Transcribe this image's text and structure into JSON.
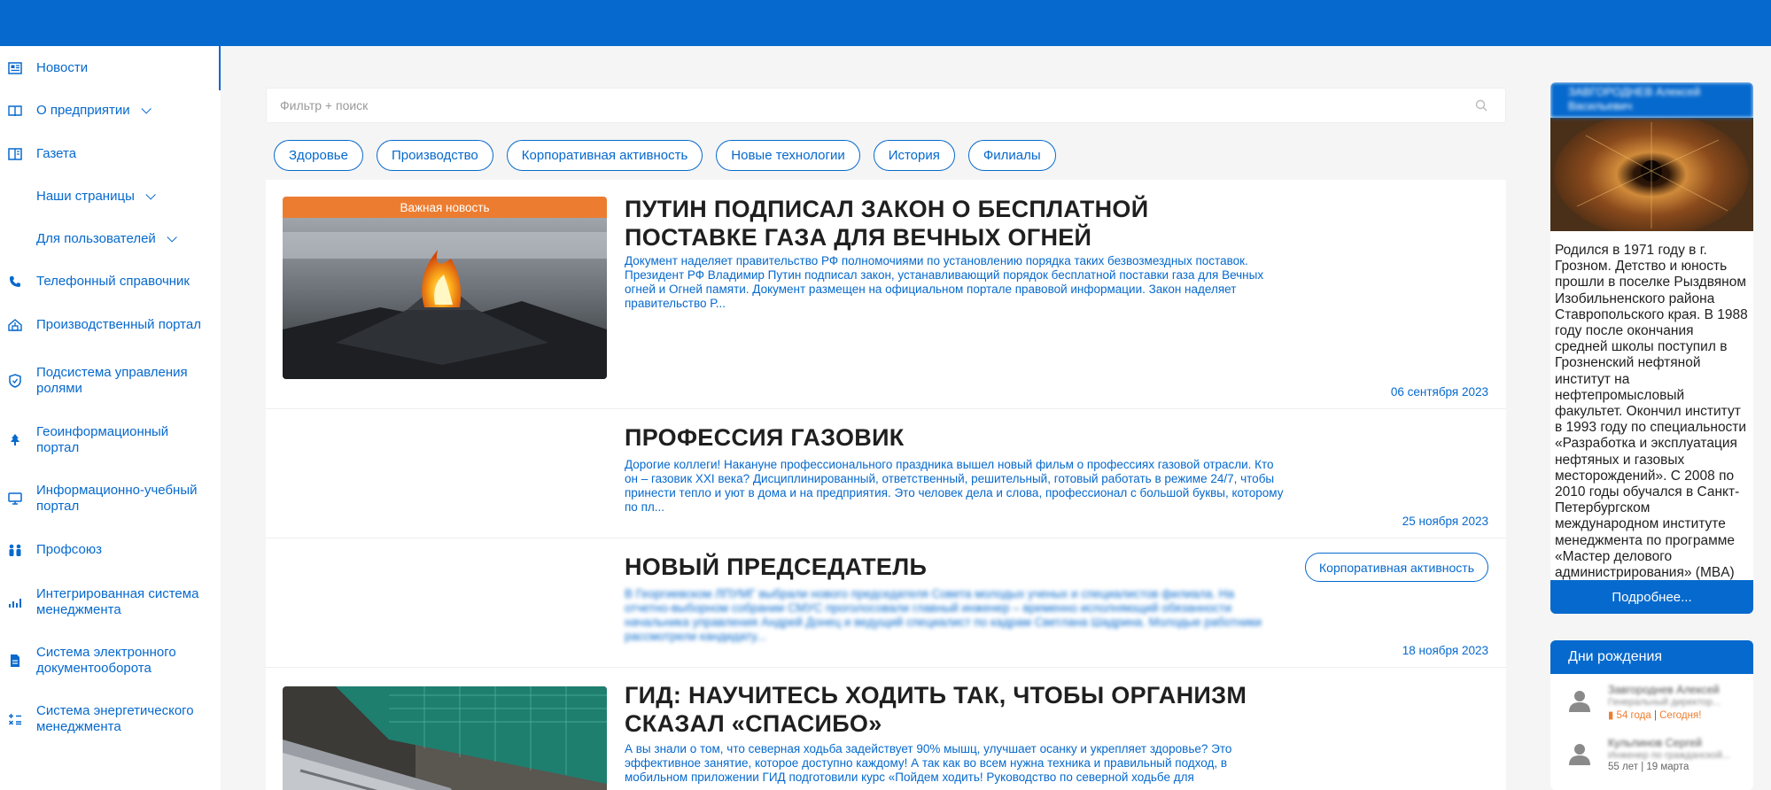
{
  "search": {
    "placeholder": "Фильтр + поиск"
  },
  "sidebar": {
    "items": [
      {
        "label": "Новости",
        "icon": "newspaper-icon"
      },
      {
        "label": "О предприятии",
        "icon": "book-open-icon"
      },
      {
        "label": "Газета",
        "icon": "columns-icon"
      },
      {
        "label": "Наши страницы"
      },
      {
        "label": "Для пользователей"
      },
      {
        "label": "Телефонный справочник",
        "icon": "phone-icon"
      },
      {
        "label": "Производственный портал",
        "icon": "factory-icon"
      },
      {
        "label": "Подсистема управления ролями",
        "icon": "shield-icon"
      },
      {
        "label": "Геоинформационный портал",
        "icon": "tree-icon"
      },
      {
        "label": "Информационно-учебный портал",
        "icon": "monitor-icon"
      },
      {
        "label": "Профсоюз",
        "icon": "people-icon"
      },
      {
        "label": "Интегрированная система менеджмента",
        "icon": "chart-icon"
      },
      {
        "label": "Система электронного документооборота",
        "icon": "document-icon"
      },
      {
        "label": "Система энергетического менеджмента",
        "icon": "calculator-icon"
      }
    ]
  },
  "chips": [
    "Здоровье",
    "Производство",
    "Корпоративная активность",
    "Новые технологии",
    "История",
    "Филиалы"
  ],
  "posts": [
    {
      "badge": "Важная новость",
      "title": "Путин подписал закон о бесплатной поставке газа для Вечных огней",
      "text": "Документ наделяет правительство РФ полномочиями по установлению порядка таких безвозмездных поставок. Президент РФ Владимир Путин подписал закон, устанавливающий порядок бесплатной поставки газа для Вечных огней и Огней памяти. Документ размещен на официальном портале правовой информации. Закон наделяет правительство Р...",
      "date": "06 сентября 2023"
    },
    {
      "title": "Профессия газовик",
      "text": "Дорогие коллеги! Накануне профессионального праздника вышел новый фильм о профессиях газовой отрасли. Кто он – газовик XXI века? Дисциплинированный, ответственный, решительный, готовый работать в режиме 24/7, чтобы принести тепло и уют в дома и на предприятия. Это человек дела и слова, профессионал с большой буквы, которому по пл...",
      "date": "25 ноября 2023"
    },
    {
      "title": "Новый председатель",
      "tag": "Корпоративная активность",
      "text": "В Георгиевском ЛПУМГ выбрали нового председателя Совета молодых ученых и специалистов филиала. На отчетно-выборном собрании СМУС проголосовали главный инженер – временно исполняющий обязанности начальника управления Андрей Донец и ведущий специалист по кадрам Светлана Шадрина. Молодые работники рассмотрели кандидату...",
      "date": "18 ноября 2023"
    },
    {
      "title": "ГИД: научитесь ходить так, чтобы организм сказал «спасибо»",
      "text": "А вы знали о том, что северная ходьба задействует 90% мышц, улучшает осанку и укрепляет здоровье? Это эффективное занятие, которое доступно каждому! А так как во всем нужна техника и правильный подход, в мобильном приложении ГИД подготовили курс «Пойдем ходить! Руководство по северной ходьбе для"
    }
  ],
  "profile": {
    "name": "ЗАВГОРОДНЕВ Алексей Васильевич",
    "bio": "Родился в 1971 году в г. Грозном. Детство и юность прошли в поселке Рыздвяном Изобильненского района Ставропольского края. В 1988 году после окончания средней школы поступил в Грозненский нефтяной институт на нефтепромысловый факультет. Окончил институт в 1993 году по специальности «Разработка и эксплуатация нефтяных и газовых месторождений». С 2008 по 2010 годы обучался в Санкт-Петербургском международном институте менеджмента по программе «Мастер делового администрирования» (MBA)",
    "more": "Подробнее..."
  },
  "birthdays": {
    "title": "Дни рождения",
    "people": [
      {
        "name": "Завгороднев Алексей",
        "role": "Генеральный директор...",
        "age": "54 года",
        "when": "Сегодня!"
      },
      {
        "name": "Кульпинов Сергей",
        "role": "Инженер по гражданской...",
        "age": "55 лет",
        "when": "19 марта"
      }
    ]
  },
  "colors": {
    "brand": "#0669cd",
    "accent": "#ec7d30"
  }
}
